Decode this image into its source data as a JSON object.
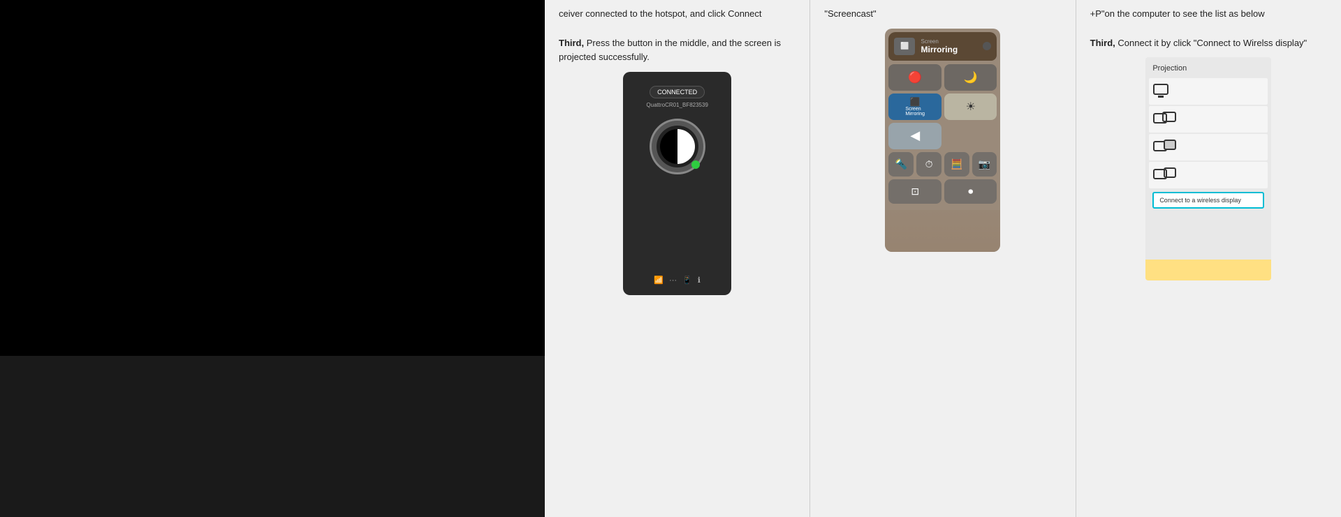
{
  "left_area": {
    "background": "#000000"
  },
  "columns": [
    {
      "id": "col1",
      "text_parts": [
        {
          "type": "normal",
          "text": "ceiver connected to the hotspot, and click Connect"
        },
        {
          "type": "bold",
          "text": "Third,"
        },
        {
          "type": "normal",
          "text": " Press the button in the middle, and the screen is projected successfully."
        }
      ],
      "screenshot": {
        "connected_label": "CONNECTED",
        "device_id": "QuattroCR01_BF823539"
      }
    },
    {
      "id": "col2",
      "text_parts": [
        {
          "type": "normal",
          "text": "\"Screencast\""
        }
      ],
      "screenshot": {
        "screen_mirror_label": "Screen\nMirroring"
      }
    },
    {
      "id": "col3",
      "text_parts": [
        {
          "type": "normal",
          "text": "+P\"on the computer to see the list as below"
        },
        {
          "type": "bold",
          "text": "Third,"
        },
        {
          "type": "normal",
          "text": " Connect it by click \"Connect to Wirelss display\""
        }
      ],
      "screenshot": {
        "title": "Projection",
        "connect_btn": "Connect to a wireless display"
      }
    }
  ]
}
